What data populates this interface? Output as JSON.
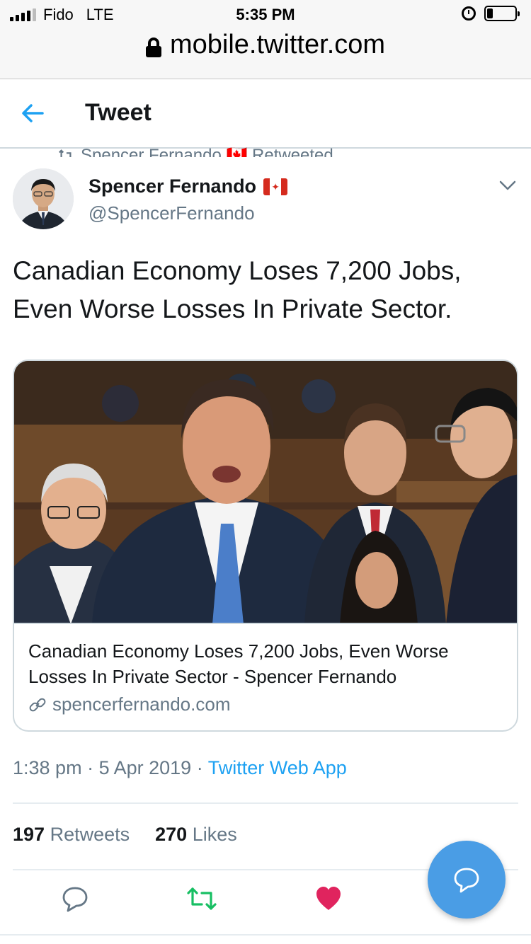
{
  "status_bar": {
    "carrier": "Fido",
    "network": "LTE",
    "time": "5:35 PM",
    "battery_level": 0.2
  },
  "browser": {
    "url": "mobile.twitter.com"
  },
  "header": {
    "title": "Tweet"
  },
  "retweet_context": {
    "text": "Spencer Fernando 🇨🇦 Retweeted"
  },
  "tweet": {
    "author_name": "Spencer Fernando",
    "author_handle": "@SpencerFernando",
    "text": "Canadian Economy Loses 7,200 Jobs, Even Worse Losses In Private Sector.",
    "card": {
      "title": "Canadian Economy Loses 7,200 Jobs, Even Worse Losses In Private Sector - Spencer Fernando",
      "domain": "spencerfernando.com"
    },
    "time": "1:38 pm",
    "date": "5 Apr 2019",
    "source": "Twitter Web App",
    "retweets_count": "197",
    "retweets_label": "Retweets",
    "likes_count": "270",
    "likes_label": "Likes"
  },
  "colors": {
    "accent": "#1da1f2",
    "retweet_green": "#17bf63",
    "like_red": "#e0245e",
    "secondary_text": "#657786",
    "fab": "#4a9de5"
  },
  "icons": {
    "back": "arrow-left-icon",
    "more": "chevron-down-icon",
    "reply": "speech-bubble-icon",
    "retweet": "retweet-icon",
    "like": "heart-icon",
    "compose": "speech-bubble-icon",
    "link": "link-icon",
    "lock": "lock-icon"
  }
}
